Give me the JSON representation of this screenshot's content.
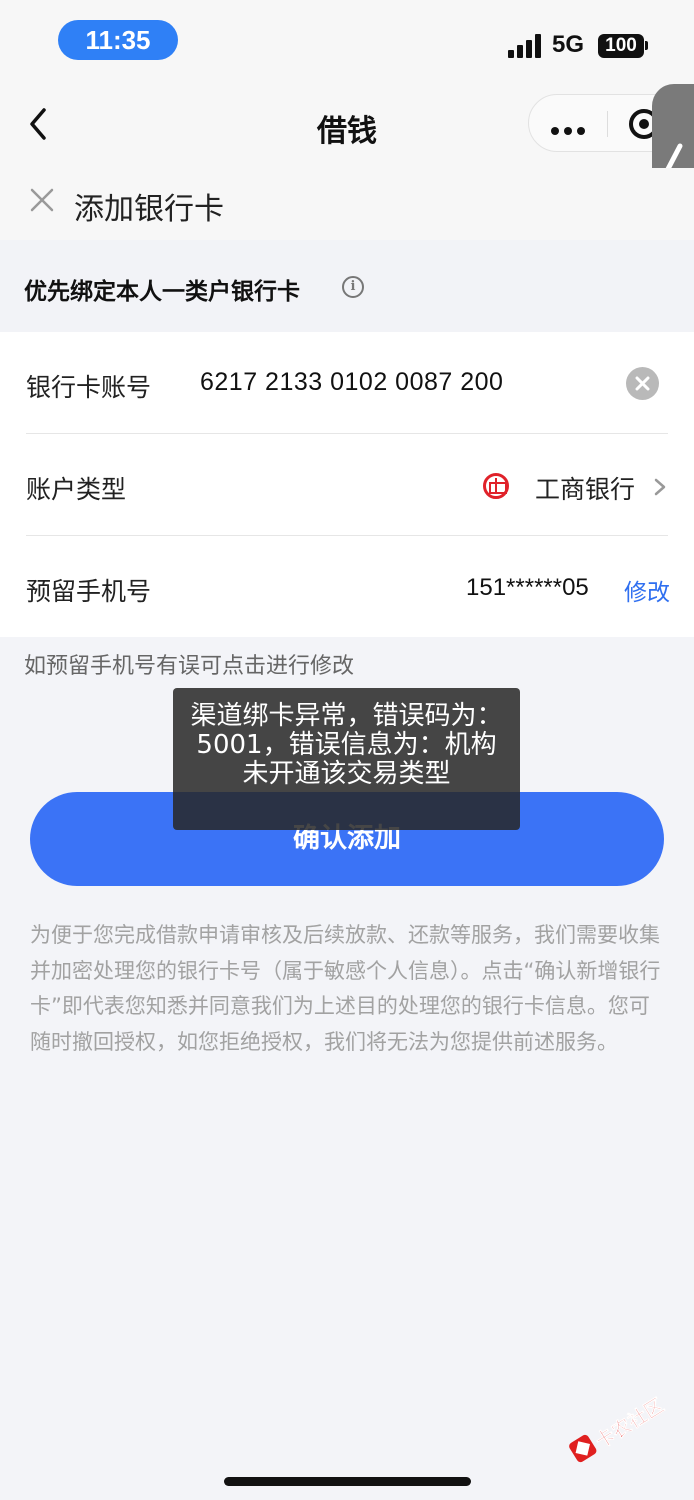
{
  "status_bar": {
    "time": "11:35",
    "network": "5G",
    "battery": "100"
  },
  "nav": {
    "title": "借钱"
  },
  "sub_header": {
    "title": "添加银行卡"
  },
  "section": {
    "title": "优先绑定本人一类户银行卡"
  },
  "form": {
    "card_row": {
      "label": "银行卡账号",
      "value": "6217 2133 0102 0087 200"
    },
    "type_row": {
      "label": "账户类型",
      "bank_name": "工商银行"
    },
    "phone_row": {
      "label": "预留手机号",
      "value": "151******05",
      "modify_label": "修改"
    }
  },
  "hint": "如预留手机号有误可点击进行修改",
  "toast": "渠道绑卡异常，错误码为：5001，错误信息为：机构未开通该交易类型",
  "confirm_button": "确认添加",
  "privacy_text": "为便于您完成借款申请审核及后续放款、还款等服务，我们需要收集并加密处理您的银行卡号（属于敏感个人信息）。点击“确认新增银行卡”即代表您知悉并同意我们为上述目的处理您的银行卡信息。您可随时撤回授权，如您拒绝授权，我们将无法为您提供前述服务。",
  "watermark": "卡农社区",
  "colors": {
    "accent": "#3b73f6",
    "link": "#2f6ff0",
    "time_pill": "#2f80f6",
    "bank_logo": "#e0222a"
  },
  "icons": [
    "back-arrow",
    "more-dots",
    "target-circle",
    "side-chevron-left",
    "close-x",
    "info-circle",
    "clear-x",
    "icbc-logo",
    "chevron-right"
  ]
}
